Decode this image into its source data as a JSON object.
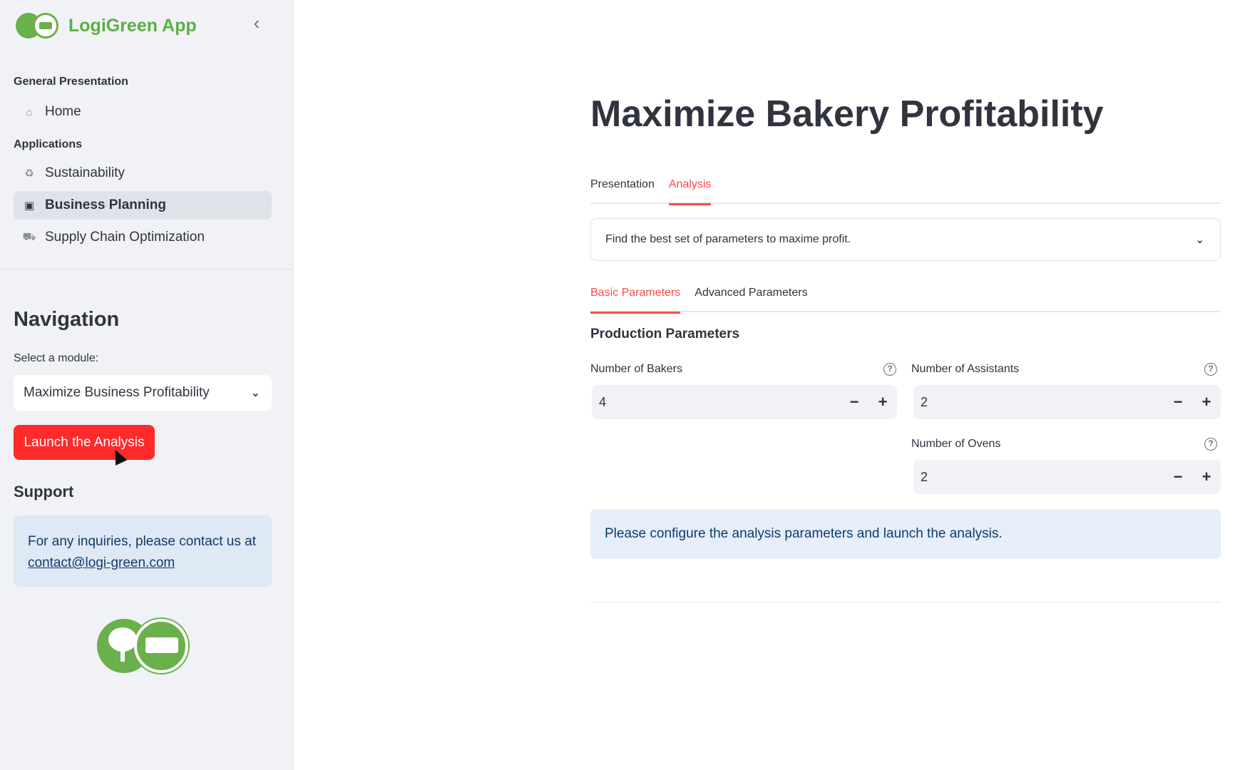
{
  "sidebar": {
    "app_title": "LogiGreen App",
    "collapse_icon": "‹",
    "sections": {
      "general": "General Presentation",
      "applications": "Applications"
    },
    "items": [
      {
        "label": "Home",
        "icon": "⌂"
      },
      {
        "label": "Sustainability",
        "icon": "♻"
      },
      {
        "label": "Business Planning",
        "icon": "▣"
      },
      {
        "label": "Supply Chain Optimization",
        "icon": "⛟"
      }
    ],
    "navigation_heading": "Navigation",
    "select_label": "Select a module:",
    "select_value": "Maximize Business Profitability",
    "launch_button": "Launch the Analysis",
    "support_heading": "Support",
    "support_text": "For any inquiries, please contact us at",
    "support_email": "contact@logi-green.com"
  },
  "main": {
    "title": "Maximize Bakery Profitability",
    "tabs": [
      {
        "label": "Presentation"
      },
      {
        "label": "Analysis"
      }
    ],
    "expander_text": "Find the best set of parameters to maxime profit.",
    "param_tabs": [
      {
        "label": "Basic Parameters"
      },
      {
        "label": "Advanced Parameters"
      }
    ],
    "section_heading": "Production Parameters",
    "fields": {
      "bakers": {
        "label": "Number of Bakers",
        "value": "4"
      },
      "assistants": {
        "label": "Number of Assistants",
        "value": "2"
      },
      "ovens": {
        "label": "Number of Ovens",
        "value": "2"
      }
    },
    "info_message": "Please configure the analysis parameters and launch the analysis."
  },
  "colors": {
    "accent": "#ff4b4b",
    "button": "#ff2b2b",
    "brand_green": "#5cae45",
    "info_bg": "#e5eefa"
  },
  "icons": {
    "chevron": "⌄",
    "minus": "−",
    "plus": "+",
    "help": "?"
  }
}
